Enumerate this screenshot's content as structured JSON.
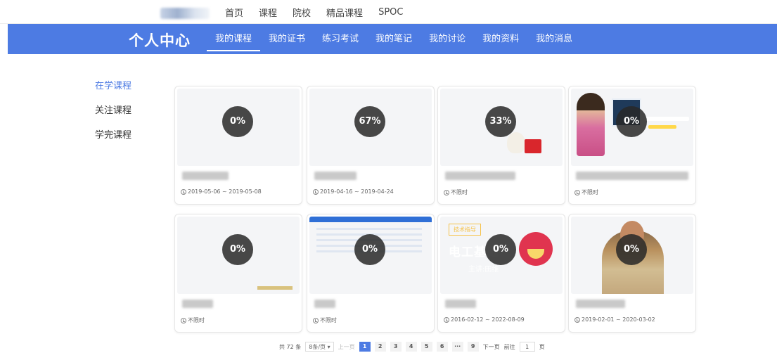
{
  "topnav": {
    "links": [
      "首页",
      "课程",
      "院校",
      "精品课程",
      "SPOC"
    ]
  },
  "header": {
    "brand": "个人中心",
    "tabs": [
      {
        "label": "我的课程",
        "active": true
      },
      {
        "label": "我的证书",
        "active": false
      },
      {
        "label": "练习考试",
        "active": false
      },
      {
        "label": "我的笔记",
        "active": false
      },
      {
        "label": "我的讨论",
        "active": false
      },
      {
        "label": "我的资料",
        "active": false
      },
      {
        "label": "我的消息",
        "active": false
      }
    ]
  },
  "sidebar": {
    "items": [
      {
        "label": "在学课程",
        "active": true
      },
      {
        "label": "关注课程",
        "active": false
      },
      {
        "label": "学完课程",
        "active": false
      }
    ]
  },
  "courses": [
    {
      "progress": "0%",
      "date": "2019-05-06 ~ 2019-05-08",
      "thumb": "plain"
    },
    {
      "progress": "67%",
      "date": "2019-04-16 ~ 2019-04-24",
      "thumb": "plain"
    },
    {
      "progress": "33%",
      "date": "不限时",
      "thumb": "bunny"
    },
    {
      "progress": "0%",
      "date": "不限时",
      "thumb": "teacher"
    },
    {
      "progress": "0%",
      "date": "不限时",
      "thumb": "diag"
    },
    {
      "progress": "0%",
      "date": "不限时",
      "thumb": "web"
    },
    {
      "progress": "0%",
      "date": "2016-02-12 ~ 2022-08-09",
      "thumb": "purple",
      "thumb_tag": "技术指导",
      "thumb_title": "电工基础",
      "thumb_sub": "主讲:田维"
    },
    {
      "progress": "0%",
      "date": "2019-02-01 ~ 2020-03-02",
      "thumb": "news"
    }
  ],
  "pagination": {
    "total": "共 72 条",
    "per_page": "8条/页",
    "prev": "上一页",
    "pages": [
      "1",
      "2",
      "3",
      "4",
      "5",
      "6",
      "···",
      "9"
    ],
    "current": "1",
    "next": "下一页",
    "goto_label": "前往",
    "goto_value": "1",
    "goto_unit": "页"
  },
  "colors": {
    "accent": "#4d7be3"
  }
}
